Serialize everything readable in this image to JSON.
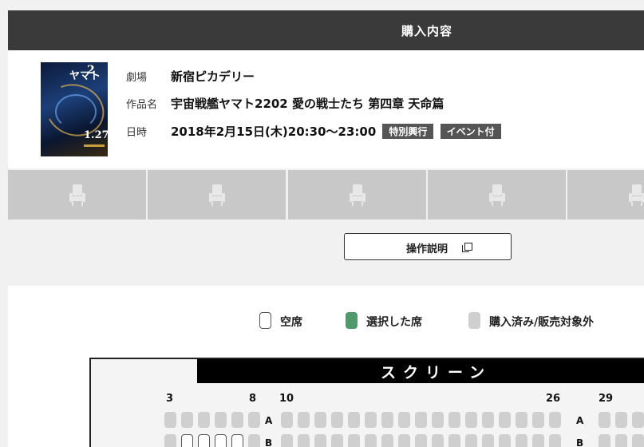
{
  "header": {
    "title": "購入内容"
  },
  "info": {
    "poster": {
      "logo": "ヤマト",
      "num": "2",
      "date": "1.27"
    },
    "theater_label": "劇場",
    "theater_value": "新宿ピカデリー",
    "title_label": "作品名",
    "title_value": "宇宙戦艦ヤマト2202 愛の戦士たち 第四章 天命篇",
    "datetime_label": "日時",
    "datetime_value": "2018年2月15日(木)20:30～23:00",
    "badges": [
      "特別興行",
      "イベント付"
    ]
  },
  "tabs": [
    "seat-tab-1",
    "seat-tab-2",
    "seat-tab-3",
    "seat-tab-4",
    "seat-tab-5"
  ],
  "help": {
    "label": "操作説明"
  },
  "legend": [
    {
      "label": "空席",
      "color": "#ffffff"
    },
    {
      "label": "選択した席",
      "color": "#4e9a6a"
    },
    {
      "label": "購入済み/販売対象外",
      "color": "#cfcfcf"
    }
  ],
  "seatmap": {
    "screen_label": "スクリーン",
    "column_numbers": [
      "3",
      "8",
      "10",
      "26",
      "29"
    ],
    "row_labels": [
      "A",
      "B"
    ],
    "colors": {
      "taken": "#cfcfcf",
      "free": "#ffffff"
    }
  }
}
